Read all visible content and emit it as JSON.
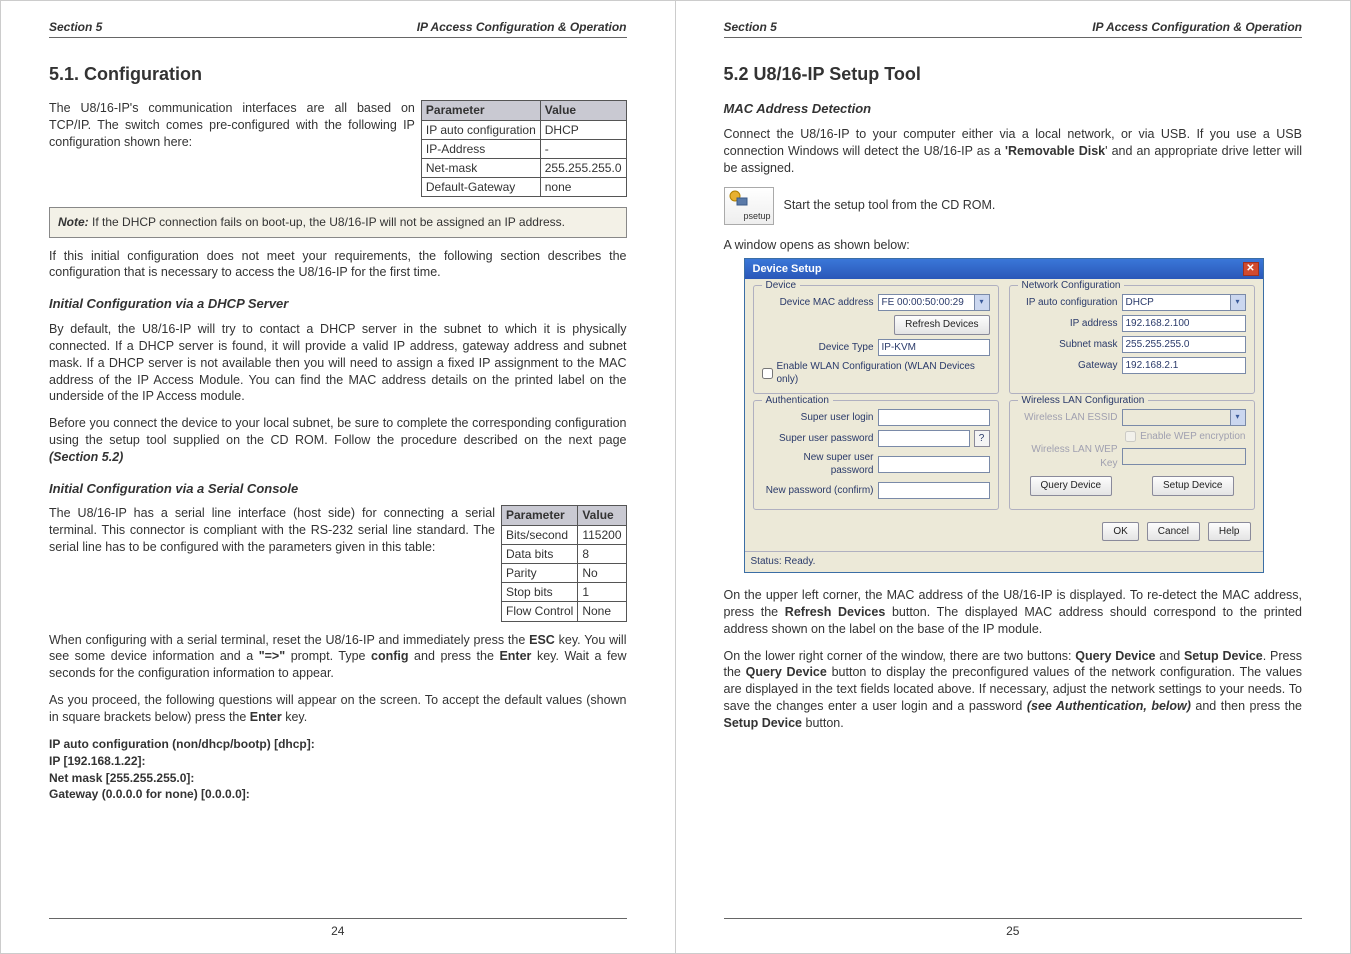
{
  "left": {
    "header": {
      "section": "Section 5",
      "title": "IP Access Configuration & Operation"
    },
    "h2": "5.1. Configuration",
    "intro": "The U8/16-IP's communication interfaces are all based on TCP/IP. The switch comes pre-configured with the following IP configuration shown here:",
    "table1": {
      "headers": [
        "Parameter",
        "Value"
      ],
      "rows": [
        [
          "IP auto configuration",
          "DHCP"
        ],
        [
          "IP-Address",
          "-"
        ],
        [
          "Net-mask",
          "255.255.255.0"
        ],
        [
          "Default-Gateway",
          "none"
        ]
      ]
    },
    "note_label": "Note:",
    "note": " If the DHCP connection fails on boot-up, the U8/16-IP will not be assigned an IP address.",
    "para2": "If this initial configuration does not meet your requirements, the following section describes the configuration that is necessary to access the U8/16-IP for the first time.",
    "h3a": "Initial Configuration via a DHCP Server",
    "para3": "By default, the U8/16-IP will try to contact a DHCP server in the subnet to which it is physically connected. If a DHCP server is found, it will provide a valid IP address, gateway address and subnet mask. If a DHCP server is not available then you will need to assign a fixed IP assignment to the MAC address of the IP Access Module. You can find the MAC address details on the printed label on the underside of the IP Access module.",
    "para4_a": "Before you connect the device to your local subnet, be sure to complete the corresponding configuration using the setup tool supplied on the CD ROM. Follow the procedure described on the next page ",
    "para4_b": "(Section 5.2)",
    "h3b": "Initial Configuration via a Serial Console",
    "para5": "The U8/16-IP has a serial line interface (host side) for connecting a serial terminal. This connector is compliant with the RS-232 serial line standard. The serial line has to be configured with the parameters given in this table:",
    "table2": {
      "headers": [
        "Parameter",
        "Value"
      ],
      "rows": [
        [
          "Bits/second",
          "115200"
        ],
        [
          "Data bits",
          "8"
        ],
        [
          "Parity",
          "No"
        ],
        [
          "Stop bits",
          "1"
        ],
        [
          "Flow Control",
          "None"
        ]
      ]
    },
    "para6_parts": [
      "When configuring with a serial terminal, reset the U8/16-IP and immediately press the ",
      "ESC",
      " key. You will see some device information and a ",
      "\"=>\"",
      " prompt. Type ",
      "config",
      " and press the ",
      "Enter",
      " key. Wait a few seconds for the configuration information to appear."
    ],
    "para7_a": "As you proceed, the following questions will appear on the screen. To accept the default values (shown in square brackets below) press the ",
    "para7_b": "Enter",
    "para7_c": " key.",
    "conf": [
      "IP auto configuration (non/dhcp/bootp) [dhcp]:",
      "IP [192.168.1.22]:",
      "Net mask [255.255.255.0]:",
      "Gateway (0.0.0.0 for none) [0.0.0.0]:"
    ],
    "footer": "24"
  },
  "right": {
    "header": {
      "section": "Section 5",
      "title": "IP Access Configuration & Operation"
    },
    "h2": "5.2  U8/16-IP Setup Tool",
    "h3a": "MAC Address Detection",
    "para1_a": "Connect the U8/16-IP to your computer either via a local network, or via USB. If you use a USB connection Windows will detect the U8/16-IP as a ",
    "para1_b": "'Removable Disk",
    "para1_c": "' and an appropriate drive letter will be assigned.",
    "icon_label": "psetup",
    "para_icon": "Start the setup tool from the CD ROM.",
    "para2": "A window opens as shown below:",
    "win": {
      "title": "Device Setup",
      "device_legend": "Device",
      "net_legend": "Network Configuration",
      "auth_legend": "Authentication",
      "wlan_legend": "Wireless LAN Configuration",
      "labels": {
        "mac": "Device MAC address",
        "refresh": "Refresh Devices",
        "dtype": "Device Type",
        "enable_wlan": "Enable WLAN Configuration (WLAN Devices only)",
        "ipauto": "IP auto configuration",
        "ipaddr": "IP address",
        "subnet": "Subnet mask",
        "gateway": "Gateway",
        "su_login": "Super user login",
        "su_pass": "Super user password",
        "new_pass": "New super user password",
        "new_pass2": "New password (confirm)",
        "essid": "Wireless LAN ESSID",
        "wep_en": "Enable WEP encryption",
        "wep_key": "Wireless LAN WEP Key",
        "query": "Query Device",
        "setup": "Setup Device",
        "ok": "OK",
        "cancel": "Cancel",
        "help": "Help",
        "status": "Status:  Ready."
      },
      "values": {
        "mac": "FE 00:00:50:00:29",
        "dtype": "IP-KVM",
        "ipauto": "DHCP",
        "ipaddr": "192.168.2.100",
        "subnet": "255.255.255.0",
        "gateway": "192.168.2.1"
      }
    },
    "para3_a": "On the upper left corner, the MAC address of the U8/16-IP is displayed. To re-detect the MAC address, press the ",
    "para3_b": "Refresh Devices",
    "para3_c": " button. The displayed MAC address should correspond to the printed address shown on the label on the base of the IP module.",
    "para4_parts": [
      "On the lower right corner of the window, there are two buttons: ",
      "Query Device",
      " and ",
      "Setup Device",
      ". Press the ",
      "Query Device",
      " button to display the preconfigured values of the network configuration. The values are displayed in the text fields located above. If necessary, adjust the network settings to your needs. To save the changes enter a user login and a password ",
      "(see Authentication, below)",
      " and then press the ",
      "Setup Device",
      " button."
    ],
    "footer": "25"
  }
}
